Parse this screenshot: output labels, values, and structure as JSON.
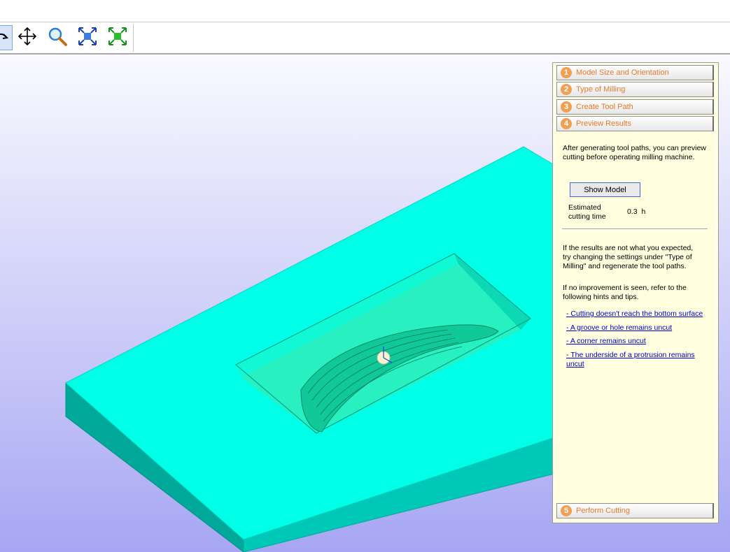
{
  "toolbar": {
    "buttons": [
      {
        "name": "rotate-icon"
      },
      {
        "name": "pan-icon"
      },
      {
        "name": "zoom-icon"
      },
      {
        "name": "fit-all-icon"
      },
      {
        "name": "fit-model-icon"
      }
    ]
  },
  "panel": {
    "steps": [
      {
        "num": "1",
        "label": "Model Size and Orientation"
      },
      {
        "num": "2",
        "label": "Type of Milling"
      },
      {
        "num": "3",
        "label": "Create Tool Path"
      },
      {
        "num": "4",
        "label": "Preview Results"
      }
    ],
    "intro": "After generating tool paths, you can preview cutting before operating milling machine.",
    "show_model_label": "Show Model",
    "est_label": "Estimated cutting time",
    "est_value": "0.3",
    "est_unit": "h",
    "hint1": "If the results are not what you expected, try changing the settings under \"Type of Milling\" and regenerate the tool paths.",
    "hint2": "If no improvement is seen, refer to the following hints and tips.",
    "links": [
      "- Cutting doesn't reach the bottom surface",
      "- A groove or hole remains uncut",
      "- A corner remains uncut",
      "- The underside of a protrusion remains uncut"
    ],
    "last_step": {
      "num": "5",
      "label": "Perform Cutting"
    }
  },
  "colors": {
    "block_top": "#00ffe6",
    "block_side_front": "#00a89a",
    "block_side_right": "#00c8b6",
    "pocket_floor": "#28f0c0",
    "panel_bg": "#ffffe0",
    "step_text": "#e8782b",
    "link": "#0000cc"
  }
}
